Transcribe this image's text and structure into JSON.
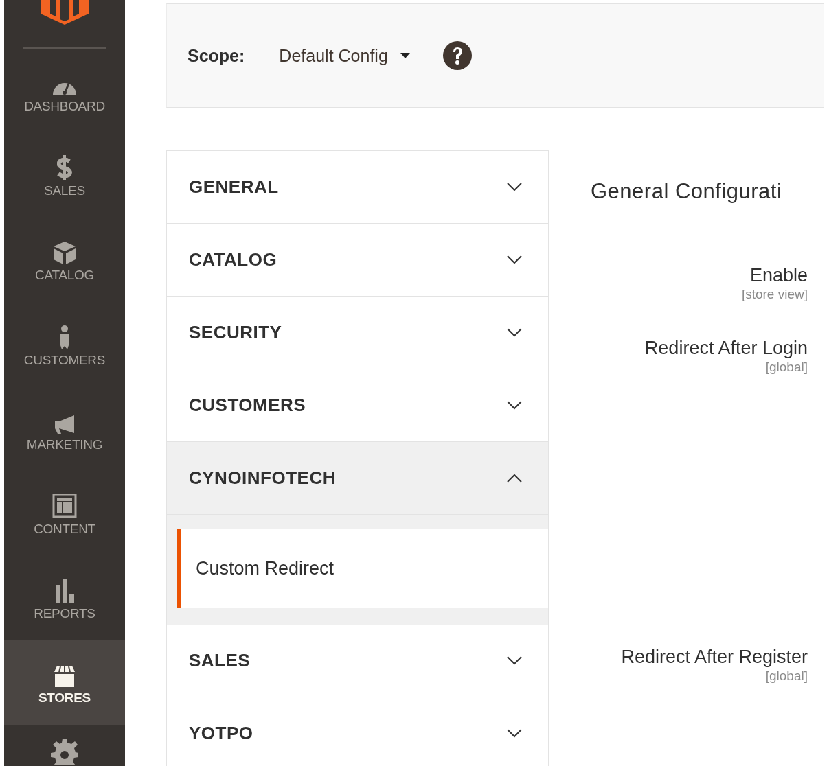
{
  "sidebar": {
    "items": [
      {
        "label": "DASHBOARD",
        "selected": false
      },
      {
        "label": "SALES",
        "selected": false
      },
      {
        "label": "CATALOG",
        "selected": false
      },
      {
        "label": "CUSTOMERS",
        "selected": false
      },
      {
        "label": "MARKETING",
        "selected": false
      },
      {
        "label": "CONTENT",
        "selected": false
      },
      {
        "label": "REPORTS",
        "selected": false
      },
      {
        "label": "STORES",
        "selected": true
      }
    ]
  },
  "scope": {
    "label": "Scope:",
    "value": "Default Config"
  },
  "sections": [
    {
      "label": "GENERAL",
      "expanded": false
    },
    {
      "label": "CATALOG",
      "expanded": false
    },
    {
      "label": "SECURITY",
      "expanded": false
    },
    {
      "label": "CUSTOMERS",
      "expanded": false
    },
    {
      "label": "CYNOINFOTECH",
      "expanded": true,
      "children": [
        {
          "label": "Custom Redirect",
          "selected": true
        }
      ]
    },
    {
      "label": "SALES",
      "expanded": false
    },
    {
      "label": "YOTPO",
      "expanded": false
    }
  ],
  "config": {
    "title": "General Configurati",
    "fields": [
      {
        "label": "Enable",
        "scope": "[store view]"
      },
      {
        "label": "Redirect After Login",
        "scope": "[global]"
      },
      {
        "label": "Redirect After Register",
        "scope": "[global]"
      }
    ]
  }
}
